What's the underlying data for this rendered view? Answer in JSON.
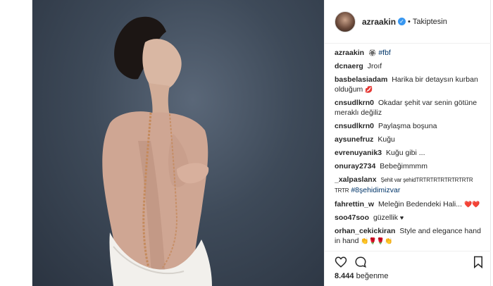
{
  "post": {
    "username": "azraakin",
    "follow_state": "Takiptesin",
    "separator": "•",
    "likes_count": "8.444",
    "likes_word": "beğenme"
  },
  "comments": [
    {
      "user": "azraakin",
      "text": "🏵",
      "tag": "#fbf"
    },
    {
      "user": "dcnaerg",
      "text": "Jroıf"
    },
    {
      "user": "basbelasiadam",
      "text": "Harika bir detaysın kurban olduğum",
      "emoji": "💋"
    },
    {
      "user": "cnsudlkrn0",
      "text": "Okadar şehit var senin götüne meraklı değiliz"
    },
    {
      "user": "cnsudlkrn0",
      "text": "Paylaşma boşuna"
    },
    {
      "user": "aysunefruz",
      "text": "Kuğu"
    },
    {
      "user": "evrenuyanik3",
      "text": "Kuğu gibi ..."
    },
    {
      "user": "onuray2734",
      "text": "Bebeğimmmm"
    },
    {
      "user": "_xalpaslanx",
      "text": "Şehit var şehidTRTRTRTRTRTRTRTR TRTR",
      "tag": "#8şehidimizvar"
    },
    {
      "user": "fahrettin_w",
      "text": "Meleğin Bedendeki Hali...",
      "emoji": "❤️❤️"
    },
    {
      "user": "soo47soo",
      "text": "güzellik",
      "emoji": "♥"
    },
    {
      "user": "orhan_cekickiran",
      "text": "Style and elegance hand in hand",
      "emoji": "👏🌹🌹👏"
    }
  ],
  "icons": {
    "verified": "verified-badge-icon",
    "like": "heart-outline-icon",
    "comment": "comment-bubble-icon",
    "save": "bookmark-icon"
  },
  "colors": {
    "verified": "#3897f0",
    "text": "#262626",
    "hashtag": "#003569",
    "border": "#efefef"
  }
}
